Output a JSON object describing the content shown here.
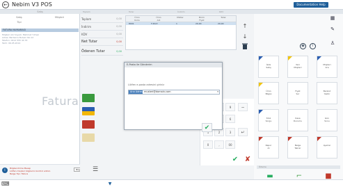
{
  "app": {
    "title": "Nebim V3 POS",
    "top_button": "Documentation Help"
  },
  "left": {
    "header": "Satış",
    "col1": "Satış\nTipi",
    "col2": "Müşteri",
    "selected": "FATURA NUMARASI",
    "details": [
      "Müşteri Adı Soyadı: Mehmet Yılmaz",
      "Adres: Barbaros Bulvarı No:12",
      "Telefon: 0212 555 44 33",
      "Tarih: 06.05.2014"
    ],
    "watermark": "Fatura",
    "footer_text": [
      "Bilgilendirme Mesajı",
      "Lütfen müşteri bilgilerini kontrol ediniz.",
      "Belge Tipi: Fatura"
    ],
    "footer_button": "Bilgi"
  },
  "center": {
    "strip": [
      "Toplam",
      "Tutar",
      "İndirim",
      "KDV"
    ],
    "summary": [
      {
        "label": "Toplam",
        "value": "0,00"
      },
      {
        "label": "İndirim",
        "value": "0,00"
      },
      {
        "label": "KDV",
        "value": "0,00"
      },
      {
        "label": "Net Tutar",
        "value": "0,00"
      },
      {
        "label": "Ödenen Tutar",
        "value": "0,00"
      }
    ],
    "grid_headers": [
      "Ürün\nKodu",
      "Ürün\nAdı",
      "Miktar",
      "Birim\nFiyat",
      "Tutar"
    ],
    "grid_row": [
      "8001",
      "T-Shirt",
      "1",
      "29,90",
      "29,90"
    ],
    "modal": {
      "title": "E-Posta ile Gönderim",
      "label": "Lütfen e-posta adresini giriniz",
      "select": "Ana Adres",
      "value": "musteri@domain.com"
    },
    "keys": [
      "7",
      "8",
      "9",
      "4",
      "5",
      "6",
      "1",
      "2",
      "3",
      "0",
      ",",
      "00"
    ]
  },
  "right": {
    "tiles": [
      [
        "İade",
        "Satış"
      ],
      [
        "Yeni",
        "Müşteri"
      ],
      [
        "Müşteri",
        "Ara"
      ],
      [
        "Ürün",
        "Bilgisi"
      ],
      [
        "Fiyat",
        "Sor"
      ],
      [
        "Barkod",
        "Yazdır"
      ],
      [
        "Stok",
        "Sorgu"
      ],
      [
        "Kasa",
        "Durumu"
      ],
      [
        "Gün",
        "Sonu"
      ],
      [
        "Rapor",
        "Al"
      ],
      [
        "Belge",
        "Tekrar"
      ],
      [
        "Ayarlar",
        ""
      ]
    ],
    "divider": "Ödeme"
  }
}
